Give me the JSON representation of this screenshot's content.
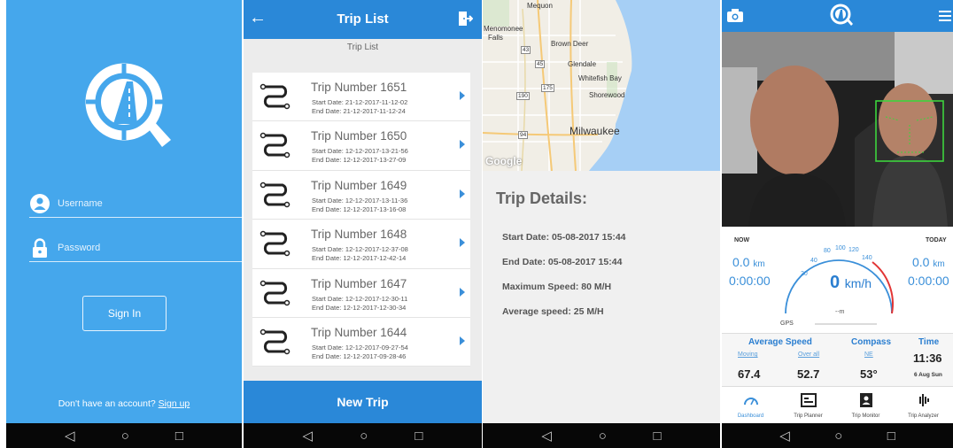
{
  "login": {
    "username_placeholder": "Username",
    "password_placeholder": "Password",
    "signin_label": "Sign In",
    "no_account_text": "Don't have an account?",
    "signup_link": "Sign up"
  },
  "trip_list": {
    "title": "Trip List",
    "subtitle": "Trip List",
    "trips": [
      {
        "name": "Trip Number 1651",
        "start": "Start Date: 21-12-2017-11-12-02",
        "end": "End Date: 21-12-2017-11-12-24"
      },
      {
        "name": "Trip Number 1650",
        "start": "Start Date: 12-12-2017-13-21-56",
        "end": "End Date: 12-12-2017-13-27-09"
      },
      {
        "name": "Trip Number 1649",
        "start": "Start Date: 12-12-2017-13-11-36",
        "end": "End Date: 12-12-2017-13-16-08"
      },
      {
        "name": "Trip Number 1648",
        "start": "Start Date: 12-12-2017-12-37-08",
        "end": "End Date: 12-12-2017-12-42-14"
      },
      {
        "name": "Trip Number 1647",
        "start": "Start Date: 12-12-2017-12-30-11",
        "end": "End Date: 12-12-2017-12-30-34"
      },
      {
        "name": "Trip Number 1644",
        "start": "Start Date: 12-12-2017-09-27-54",
        "end": "End Date: 12-12-2017-09-28-46"
      }
    ],
    "new_trip_label": "New Trip"
  },
  "trip_details": {
    "map_labels": {
      "mequon": "Mequon",
      "menomonee": "Menomonee",
      "falls": "Falls",
      "brown_deer": "Brown Deer",
      "glendale": "Glendale",
      "whitefish_bay": "Whitefish Bay",
      "shorewood": "Shorewood",
      "milwaukee": "Milwaukee",
      "google": "Google",
      "hwy_43": "43",
      "hwy_45": "45",
      "hwy_190": "190",
      "hwy_175": "175",
      "hwy_94": "94"
    },
    "title": "Trip Details:",
    "start_date": "Start Date: 05-08-2017 15:44",
    "end_date": "End Date: 05-08-2017 15:44",
    "max_speed": "Maximum Speed: 80 M/H",
    "avg_speed": "Average speed: 25 M/H"
  },
  "dashboard": {
    "now_label": "NOW",
    "now_km": "0.0",
    "now_time": "0:00:00",
    "today_label": "TODAY",
    "today_km": "0.0",
    "today_time": "0:00:00",
    "km_unit": "km",
    "speed_value": "0",
    "speed_unit": "km/h",
    "gauge_ticks": [
      "20",
      "40",
      "80",
      "100",
      "120",
      "140"
    ],
    "altitude": "--m",
    "gps_label": "GPS",
    "avg_speed_label": "Average Speed",
    "moving_label": "Moving",
    "moving_value": "67.4",
    "overall_label": "Over all",
    "overall_value": "52.7",
    "compass_label": "Compass",
    "compass_dir": "NE",
    "compass_value": "53°",
    "time_label": "Time",
    "time_value": "11:36",
    "date_value": "6 Aug Sun",
    "tabs": [
      "Dashboard",
      "Trip Planner",
      "Trip Monitor",
      "Trip Analyzer"
    ]
  },
  "colors": {
    "login_bg": "#45a7ec",
    "header_blue": "#2a88d8",
    "accent": "#3a8fd9",
    "nav_bg": "#070707"
  }
}
